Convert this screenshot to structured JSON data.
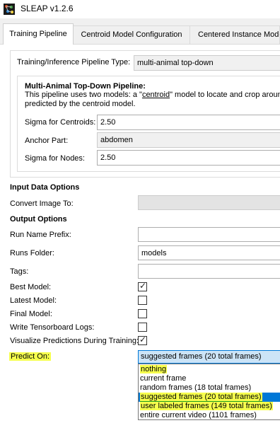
{
  "window": {
    "title": "SLEAP v1.2.6"
  },
  "tabs": [
    {
      "label": "Training Pipeline"
    },
    {
      "label": "Centroid Model Configuration"
    },
    {
      "label": "Centered Instance Mode"
    }
  ],
  "pipeline": {
    "type_label": "Training/Inference Pipeline Type:",
    "type_value": "multi-animal top-down",
    "heading": "Multi-Animal Top-Down Pipeline:",
    "desc_pre": "This pipeline uses two models: a \"",
    "desc_link": "centroid",
    "desc_post": "\" model to locate and crop around",
    "desc_line2": "predicted by the centroid model.",
    "sigma_centroids_label": "Sigma for Centroids:",
    "sigma_centroids_value": "2.50",
    "anchor_part_label": "Anchor Part:",
    "anchor_part_value": "abdomen",
    "sigma_nodes_label": "Sigma for Nodes:",
    "sigma_nodes_value": "2.50"
  },
  "input_data": {
    "heading": "Input Data Options",
    "convert_label": "Convert Image To:",
    "convert_value": ""
  },
  "output": {
    "heading": "Output Options",
    "run_name_label": "Run Name Prefix:",
    "run_name_value": "",
    "runs_folder_label": "Runs Folder:",
    "runs_folder_value": "models",
    "tags_label": "Tags:",
    "tags_value": "",
    "best_model_label": "Best Model:",
    "best_model_checked": true,
    "latest_model_label": "Latest Model:",
    "latest_model_checked": false,
    "final_model_label": "Final Model:",
    "final_model_checked": false,
    "tensorboard_label": "Write Tensorboard Logs:",
    "tensorboard_checked": false,
    "visualize_label": "Visualize Predictions During Training:",
    "visualize_checked": true,
    "predict_on_label": "Predict On:",
    "predict_on_value": "suggested frames (20 total frames)",
    "predict_on_options": [
      "nothing",
      "current frame",
      "random frames (18 total frames)",
      "suggested frames (20 total frames)",
      "user labeled frames (149 total frames)",
      "entire current video (1101 frames)"
    ]
  },
  "colors": {
    "highlight_yellow": "#f6ff4d",
    "selection_blue": "#0078d7",
    "link": "#0000ee"
  },
  "icons": {
    "app": "sleap-app-icon",
    "check": "checkmark-icon"
  }
}
